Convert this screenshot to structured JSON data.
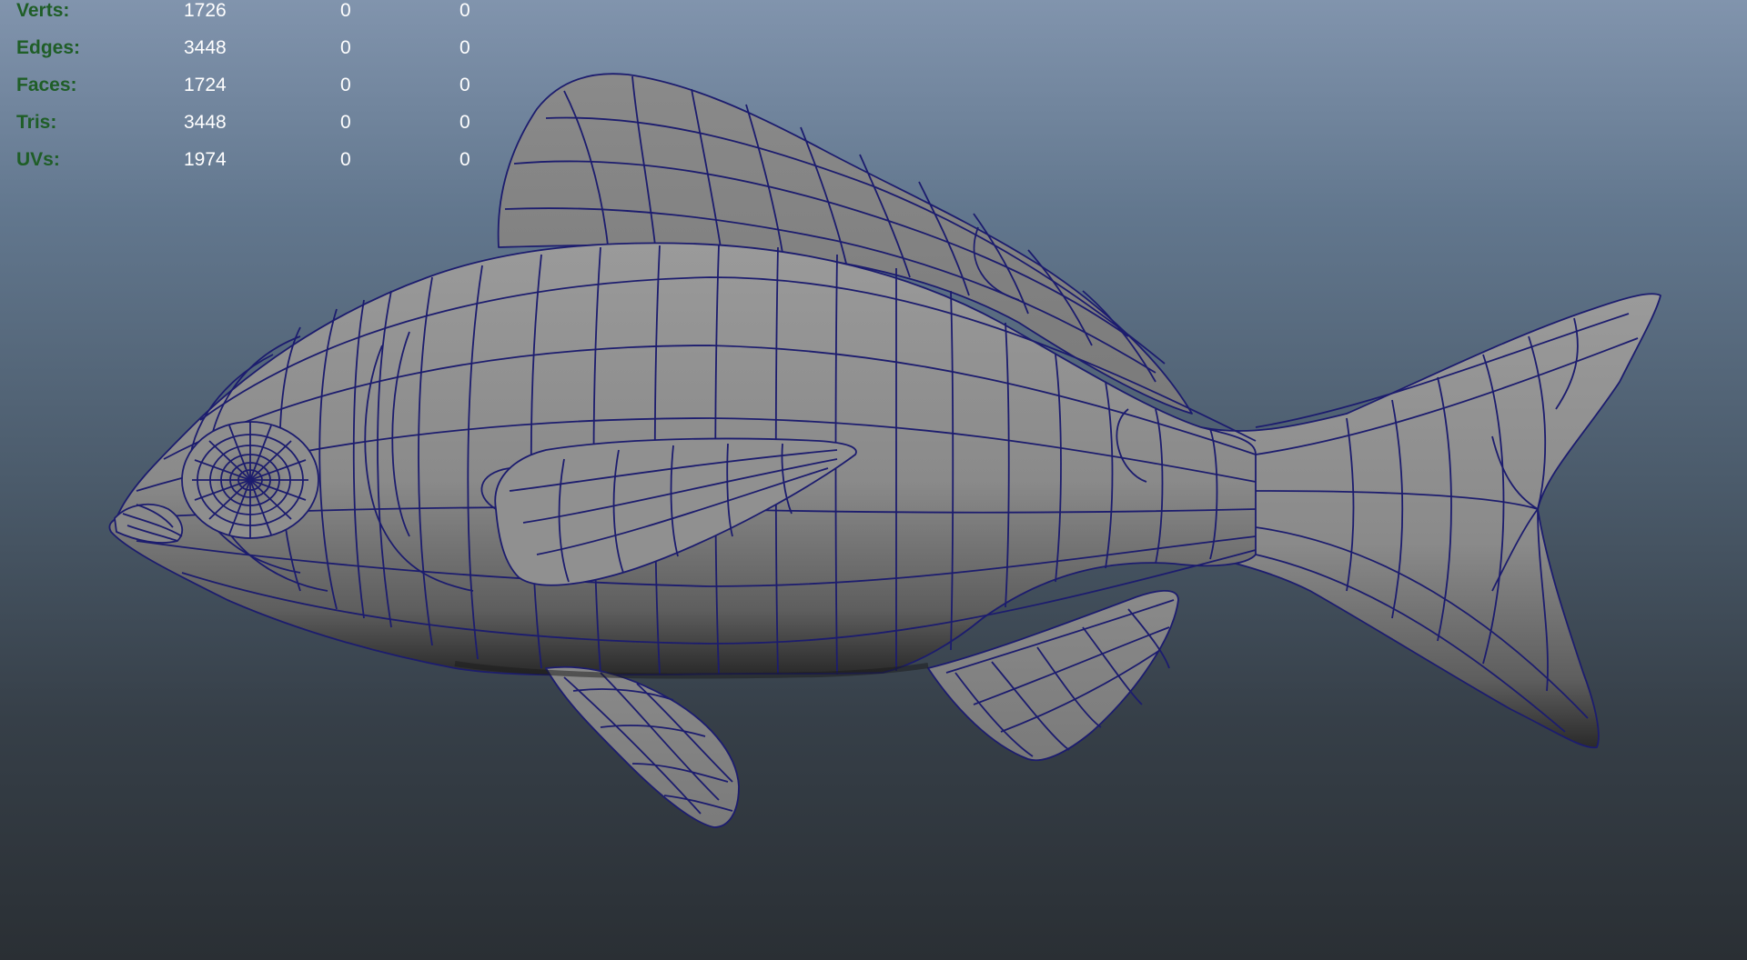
{
  "viewport": {
    "background_top": "#8194ad",
    "background_bottom": "#2a2f34"
  },
  "hud": {
    "label_color": "#1f5e27",
    "value_color": "#ffffff",
    "rows": [
      {
        "label": "Verts:",
        "c1": "1726",
        "c2": "0",
        "c3": "0"
      },
      {
        "label": "Edges:",
        "c1": "3448",
        "c2": "0",
        "c3": "0"
      },
      {
        "label": "Faces:",
        "c1": "1724",
        "c2": "0",
        "c3": "0"
      },
      {
        "label": "Tris:",
        "c1": "3448",
        "c2": "0",
        "c3": "0"
      },
      {
        "label": "UVs:",
        "c1": "1974",
        "c2": "0",
        "c3": "0"
      }
    ]
  },
  "model": {
    "subject": "fish-mesh",
    "surface_color": "#8c8c8c",
    "wire_color": "#1c1c6e"
  }
}
